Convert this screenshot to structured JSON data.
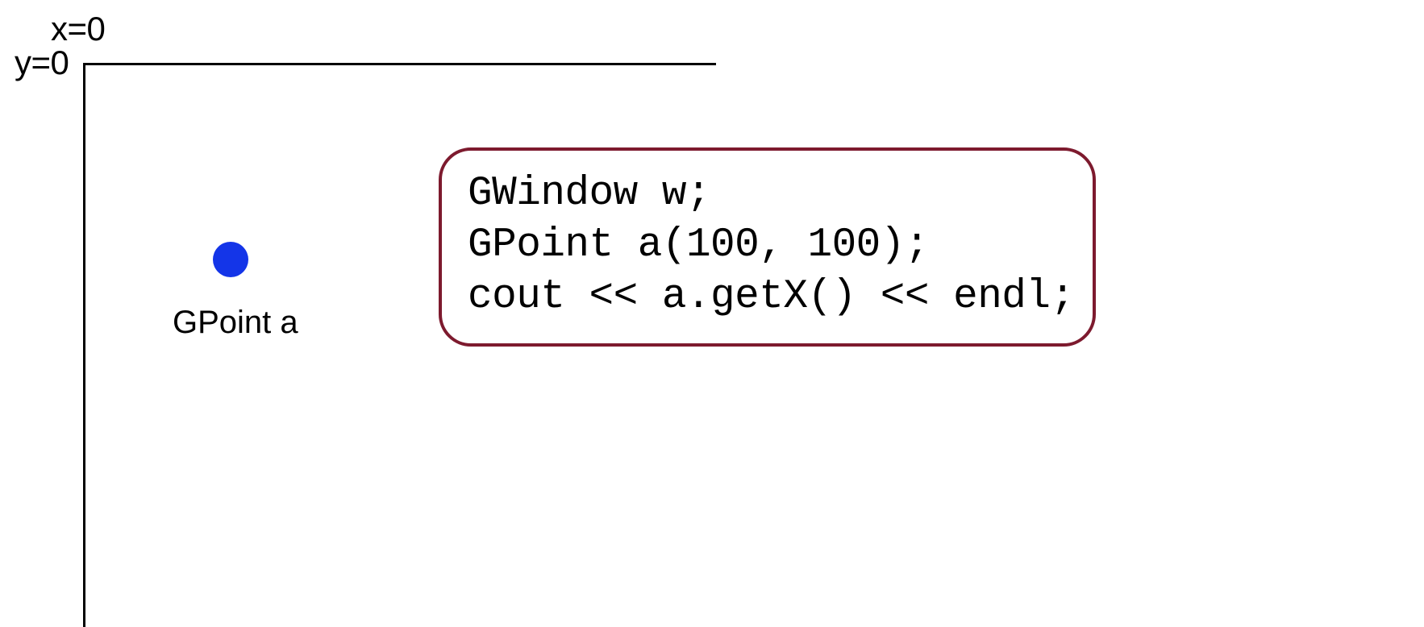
{
  "axes": {
    "xLabel": "x=0",
    "yLabel": "y=0"
  },
  "point": {
    "label": "GPoint a",
    "color": "#1435e8"
  },
  "code": {
    "line1": "GWindow w;",
    "line2": "GPoint a(100, 100);",
    "line3": "cout << a.getX() << endl;"
  }
}
